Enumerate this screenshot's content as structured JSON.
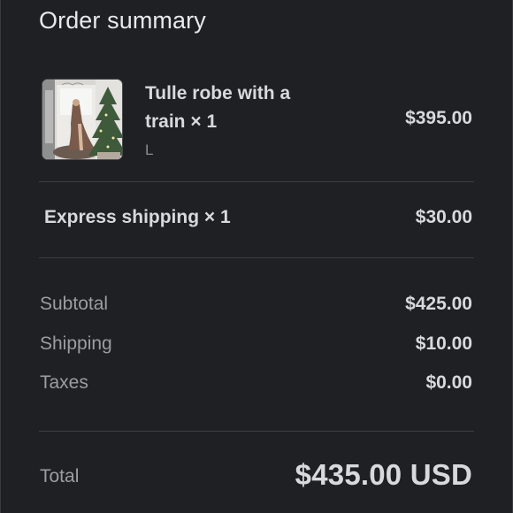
{
  "summary": {
    "title": "Order summary"
  },
  "product": {
    "image_icon": "product-thumbnail",
    "name": "Tulle robe with a train × 1",
    "variant": "L",
    "price": "$395.00"
  },
  "shipping_item": {
    "name": "Express shipping × 1",
    "price": "$30.00"
  },
  "totals": {
    "subtotal_label": "Subtotal",
    "subtotal_value": "$425.00",
    "shipping_label": "Shipping",
    "shipping_value": "$10.00",
    "taxes_label": "Taxes",
    "taxes_value": "$0.00",
    "total_label": "Total",
    "total_value": "$435.00 USD"
  },
  "colors": {
    "background": "#1f2023",
    "text_primary": "#d8d9dc",
    "text_secondary": "#9c9da1",
    "divider": "#3d3e42"
  }
}
